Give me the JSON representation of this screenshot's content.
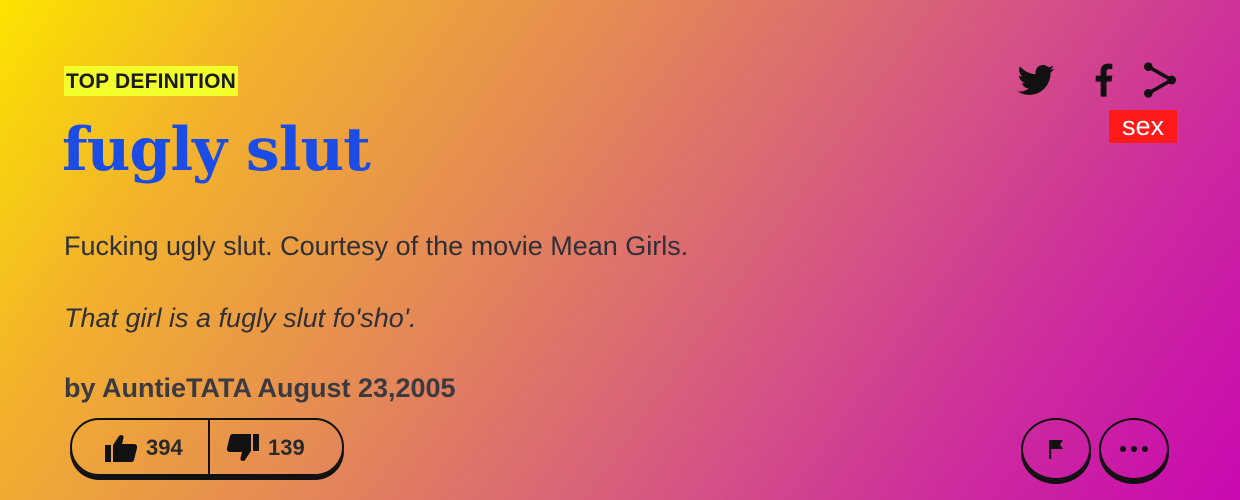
{
  "definition": {
    "badge": "TOP DEFINITION",
    "word": "fugly slut",
    "meaning": "Fucking ugly slut. Courtesy of the movie Mean Girls.",
    "example": "That girl is a fugly slut fo'sho'.",
    "by_prefix": "by",
    "author": "AuntieTATA",
    "date": "August 23,2005"
  },
  "tags": [
    {
      "label": "sex",
      "color": "#ff1a1a"
    }
  ],
  "share": {
    "icons": [
      "twitter-icon",
      "facebook-icon",
      "share-icon"
    ]
  },
  "votes": {
    "up": "394",
    "down": "139"
  },
  "actions": {
    "icons": [
      "flag-icon",
      "more-icon"
    ]
  },
  "colors": {
    "word": "#1b4de4",
    "badge_bg": "#f2ff2b",
    "tag_bg": "#ff1a1a",
    "gradient": [
      "#fbe400",
      "#f3b22c",
      "#e3855a",
      "#d65a80",
      "#cc2a9e",
      "#c808b0"
    ]
  }
}
